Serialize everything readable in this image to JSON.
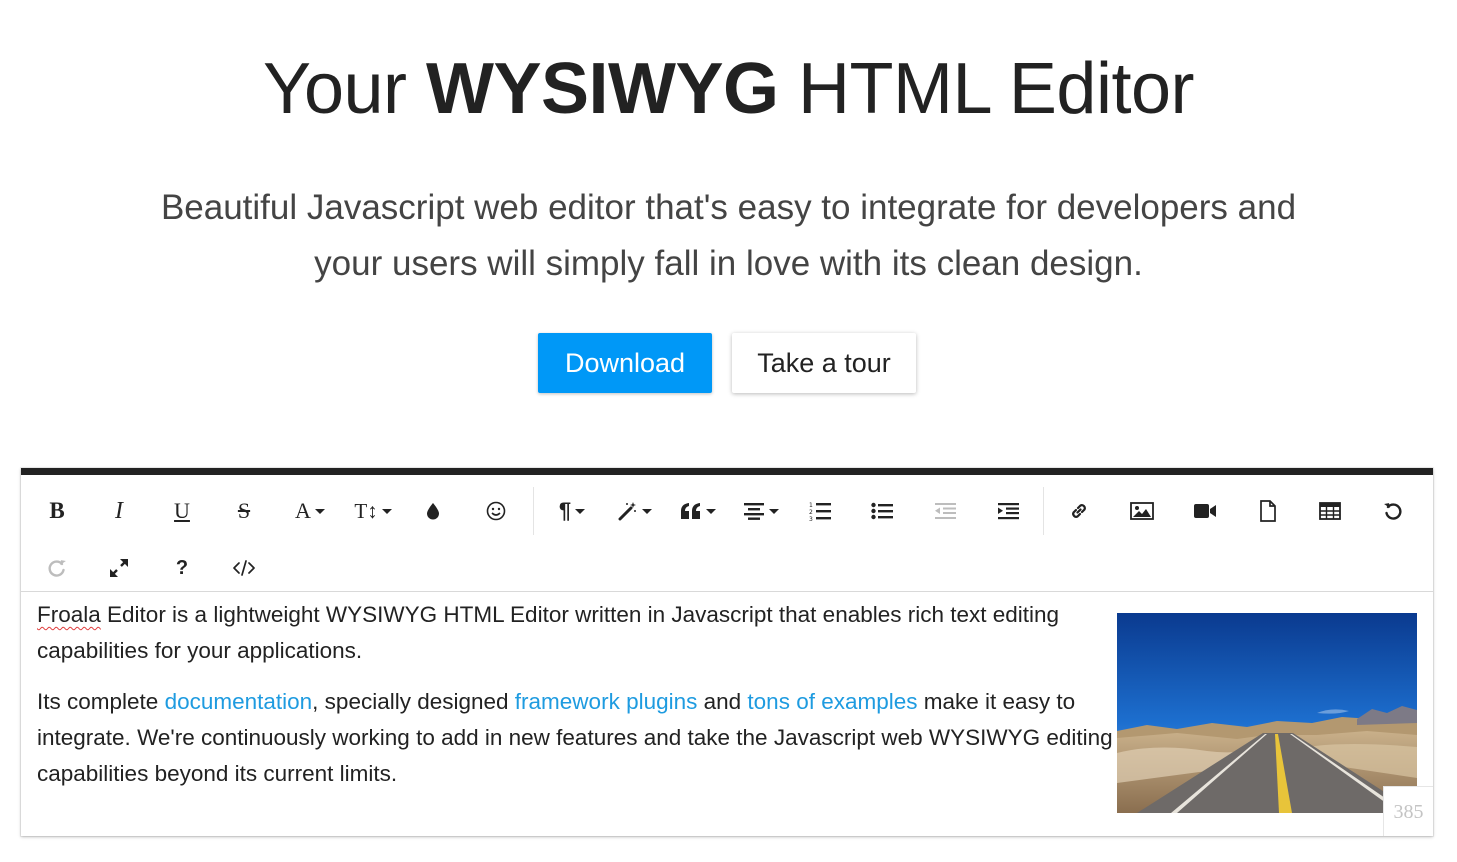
{
  "hero": {
    "title_pre": "Your",
    "title_bold": "WYSIWYG",
    "title_post": "HTML Editor",
    "subtitle_line1": "Beautiful Javascript web editor that's easy to integrate for developers and",
    "subtitle_line2": "your users will simply fall in love with its clean design.",
    "download_label": "Download",
    "tour_label": "Take a tour"
  },
  "colors": {
    "accent": "#0098f7",
    "link": "#1e9be0",
    "editor_top_border": "#222222"
  },
  "toolbar": {
    "buttons": [
      {
        "name": "bold",
        "icon": "B"
      },
      {
        "name": "italic",
        "icon": "I"
      },
      {
        "name": "underline",
        "icon": "U"
      },
      {
        "name": "strikethrough",
        "icon": "S"
      },
      {
        "name": "font-family",
        "icon": "A",
        "dropdown": true
      },
      {
        "name": "font-size",
        "icon": "T↕",
        "dropdown": true
      },
      {
        "name": "color",
        "icon": "drop-icon"
      },
      {
        "name": "emoticons",
        "icon": "smile-icon"
      },
      {
        "name": "paragraph-format",
        "icon": "¶",
        "dropdown": true
      },
      {
        "name": "paragraph-style",
        "icon": "magic-wand-icon",
        "dropdown": true
      },
      {
        "name": "quote",
        "icon": "quote-icon",
        "dropdown": true
      },
      {
        "name": "align",
        "icon": "align-center-icon",
        "dropdown": true
      },
      {
        "name": "ordered-list",
        "icon": "ordered-list-icon"
      },
      {
        "name": "unordered-list",
        "icon": "unordered-list-icon"
      },
      {
        "name": "outdent",
        "icon": "outdent-icon",
        "disabled": true
      },
      {
        "name": "indent",
        "icon": "indent-icon"
      },
      {
        "name": "insert-link",
        "icon": "link-icon"
      },
      {
        "name": "insert-image",
        "icon": "image-icon"
      },
      {
        "name": "insert-video",
        "icon": "video-icon"
      },
      {
        "name": "insert-file",
        "icon": "file-icon"
      },
      {
        "name": "insert-table",
        "icon": "table-icon"
      },
      {
        "name": "undo",
        "icon": "undo-icon"
      },
      {
        "name": "redo",
        "icon": "redo-icon",
        "disabled": true
      },
      {
        "name": "fullscreen",
        "icon": "expand-icon"
      },
      {
        "name": "help",
        "icon": "?"
      },
      {
        "name": "html-view",
        "icon": "code-icon"
      }
    ],
    "glyphs": {
      "bold": "B",
      "italic": "I",
      "underline": "U",
      "strike": "S",
      "font_family": "A",
      "font_size": "T↕",
      "paragraph": "¶",
      "help": "?"
    }
  },
  "content": {
    "p1_misspelled": "Froala",
    "p1_rest": " Editor is a lightweight WYSIWYG HTML Editor written in Javascript that enables rich text editing capabilities for your applications.",
    "p2_part1": "Its complete ",
    "p2_link1": "documentation",
    "p2_part2": ", specially designed ",
    "p2_link2": "framework plugins",
    "p2_part3": " and ",
    "p2_link3": "tons of examples",
    "p2_part4": " make it easy to integrate. We're continuously working to add in new features and take the Javascript web WYSIWYG editing capabilities beyond its current limits."
  },
  "image": {
    "subject": "desert road under blue sky"
  },
  "counter": "385"
}
